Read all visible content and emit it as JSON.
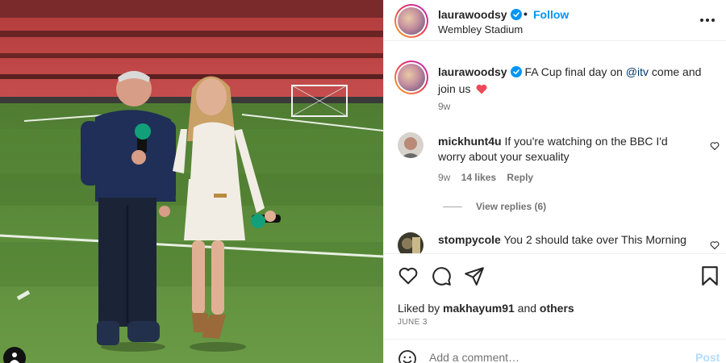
{
  "post": {
    "username": "laurawoodsy",
    "follow_label": "Follow",
    "separator": "•",
    "location": "Wembley Stadium",
    "caption_text": "FA Cup final day on ",
    "caption_mention": "@itv",
    "caption_text_2": " come and join us",
    "caption_emoji": "heart-emoji",
    "caption_age": "9w"
  },
  "comments": [
    {
      "username": "mickhunt4u",
      "text": "If you're watching on the BBC I'd worry about your sexuality",
      "age": "9w",
      "likes": "14 likes",
      "reply_label": "Reply",
      "view_replies": "View replies (6)"
    },
    {
      "username": "stompycole",
      "text": "You 2 should take over This Morning"
    }
  ],
  "actions": {
    "icons": [
      "heart-icon",
      "comment-icon",
      "share-icon",
      "bookmark-icon"
    ]
  },
  "liked_by": {
    "prefix": "Liked by ",
    "user": "makhayum91",
    "middle": " and ",
    "others": "others"
  },
  "date": "JUNE 3",
  "comment_box": {
    "placeholder": "Add a comment…",
    "post_label": "Post"
  },
  "colors": {
    "accent": "#0095f6",
    "verified": "#0095f6",
    "heart": "#ed4956",
    "post_disabled": "#b3dbff"
  }
}
